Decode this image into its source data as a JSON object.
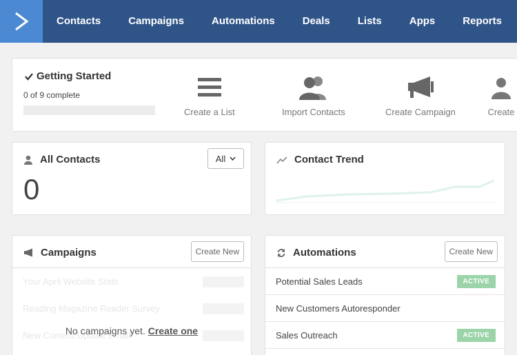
{
  "nav": {
    "items": [
      "Contacts",
      "Campaigns",
      "Automations",
      "Deals",
      "Lists",
      "Apps",
      "Reports"
    ]
  },
  "getting_started": {
    "title": "Getting Started",
    "progress_text": "0 of 9 complete",
    "progress": 0,
    "steps": [
      {
        "label": "Create a List",
        "icon": "list-icon"
      },
      {
        "label": "Import Contacts",
        "icon": "users-icon"
      },
      {
        "label": "Create Campaign",
        "icon": "megaphone-icon"
      },
      {
        "label": "Create",
        "icon": "user-icon"
      }
    ]
  },
  "contacts_card": {
    "title": "All Contacts",
    "count": "0",
    "filter": "All"
  },
  "trend_card": {
    "title": "Contact Trend"
  },
  "campaigns_card": {
    "title": "Campaigns",
    "create_label": "Create New",
    "ghost_rows": [
      "Your April Website Stats",
      "Reading Magazine Reader Survey",
      "New Content Update Email"
    ],
    "empty_text": "No campaigns yet.",
    "empty_link": "Create one"
  },
  "automations_card": {
    "title": "Automations",
    "create_label": "Create New",
    "rows": [
      {
        "name": "Potential Sales Leads",
        "status": "ACTIVE"
      },
      {
        "name": "New Customers Autoresponder",
        "status": ""
      },
      {
        "name": "Sales Outreach",
        "status": "ACTIVE"
      }
    ]
  },
  "colors": {
    "nav_bg": "#2f5488",
    "logo_bg": "#4b8ad2",
    "active_badge": "#9bd4a8"
  }
}
